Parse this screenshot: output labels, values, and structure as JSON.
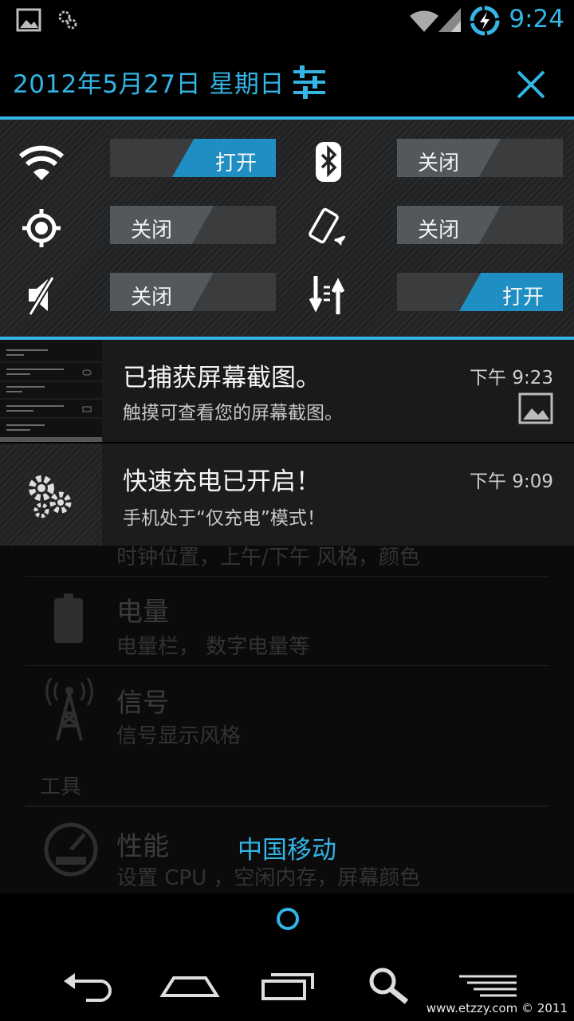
{
  "status_bar": {
    "time": "9:24",
    "icons": [
      "picture-icon",
      "gear-icon",
      "wifi-icon",
      "signal-icon",
      "battery-charging-icon"
    ]
  },
  "header": {
    "date": "2012年5月27日 星期日",
    "settings_icon": "sliders-icon",
    "close_icon": "close-icon"
  },
  "toggles": [
    {
      "icon": "wifi-icon",
      "state": "打开",
      "on": true
    },
    {
      "icon": "bluetooth-icon",
      "state": "关闭",
      "on": false
    },
    {
      "icon": "gps-icon",
      "state": "关闭",
      "on": false
    },
    {
      "icon": "rotate-icon",
      "state": "关闭",
      "on": false
    },
    {
      "icon": "sound-muted-icon",
      "state": "关闭",
      "on": false
    },
    {
      "icon": "data-transfer-icon",
      "state": "打开",
      "on": true
    }
  ],
  "notifications": [
    {
      "title": "已捕获屏幕截图。",
      "text": "触摸可查看您的屏幕截图。",
      "time": "下午 9:23",
      "icon": "picture-icon"
    },
    {
      "title": "快速充电已开启！",
      "text": "手机处于“仅充电”模式！",
      "time": "下午 9:09",
      "icon": "gears-icon"
    }
  ],
  "background_app": {
    "partial_text": "时钟位置，上午/下午 风格，颜色",
    "items": [
      {
        "title": "电量",
        "subtitle": "电量栏， 数字电量等",
        "icon": "battery-icon"
      },
      {
        "title": "信号",
        "subtitle": "信号显示风格",
        "icon": "signal-tower-icon"
      }
    ],
    "section": "工具",
    "perf": {
      "title": "性能",
      "subtitle": "设置 CPU ，空闲内存，屏幕颜色",
      "icon": "aokp-gauge-icon"
    }
  },
  "carrier": "中国移动",
  "nav_buttons": [
    "back-icon",
    "home-icon",
    "recent-apps-icon",
    "search-icon",
    "menu-icon"
  ],
  "watermark": "www.etzzy.com © 2011"
}
